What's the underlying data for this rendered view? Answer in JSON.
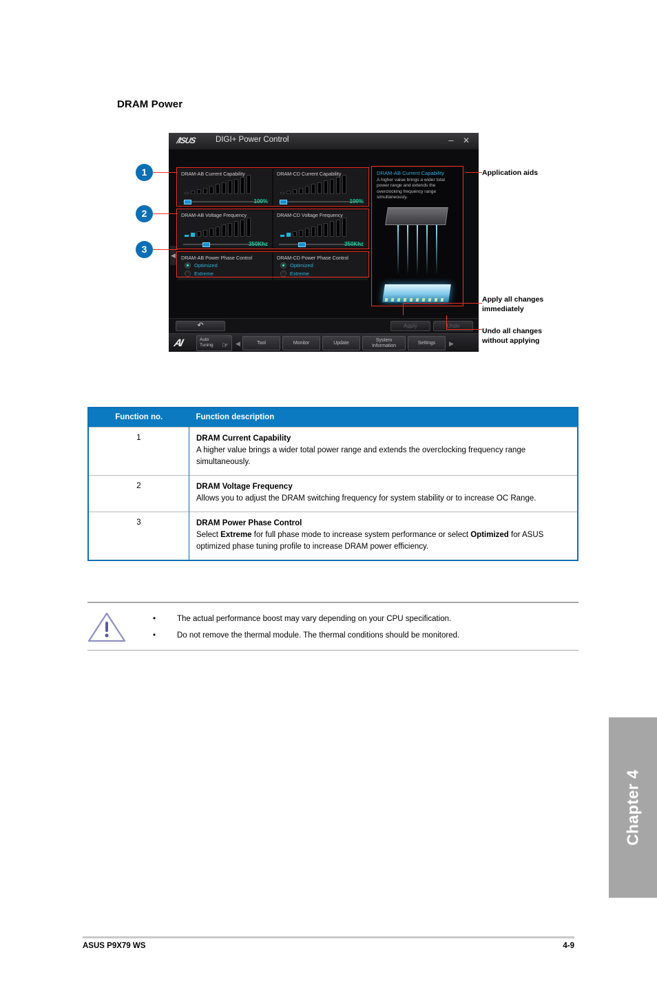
{
  "page": {
    "heading": "DRAM Power",
    "footer_left": "ASUS P9X79 WS",
    "footer_right": "4-9",
    "chapter_tab": "Chapter 4"
  },
  "colors": {
    "accent_blue": "#0b7ac0",
    "callout_blue": "#0b6fb5",
    "annotation_red": "#ee3124",
    "chapter_grey": "#a6a6a6",
    "app_value_green": "#16cfa0",
    "app_cyan": "#2fb3d8"
  },
  "app": {
    "brand": "/ISUS",
    "title": "DIGI+ Power Control",
    "window_buttons": {
      "minimize": "–",
      "close": "✕"
    },
    "left_collapse_icon": "◀",
    "panels": [
      {
        "title": "DRAM-AB Current Capability",
        "value": "100%",
        "slider_pct": 2,
        "lit_bars": 0
      },
      {
        "title": "DRAM-CD Current Capability",
        "value": "100%",
        "slider_pct": 2,
        "lit_bars": 0
      },
      {
        "title": "DRAM-AB Voltage Frequency",
        "value": "350Khz",
        "slider_pct": 26,
        "lit_bars": 2
      },
      {
        "title": "DRAM-CD Voltage Frequency",
        "value": "350Khz",
        "slider_pct": 26,
        "lit_bars": 2
      }
    ],
    "phase": [
      {
        "title": "DRAM-AB Power Phase Control",
        "options": [
          "Optimized",
          "Extreme"
        ],
        "selected": "Optimized"
      },
      {
        "title": "DRAM-CD Power Phase Control",
        "options": [
          "Optimized",
          "Extreme"
        ],
        "selected": "Optimized"
      }
    ],
    "aid": {
      "title": "DRAM-AB Current Capability",
      "text": "A higher value brings a wider total power range and extends the overclocking frequency range simultaneously."
    },
    "action_bar": {
      "back": "↶",
      "apply": "Apply",
      "undo": "Undo"
    },
    "nav": {
      "logo": "AI",
      "auto_tuning": "Auto\nTuning",
      "prev_arrow": "◀",
      "next_arrow": "▶",
      "buttons": [
        "Tool",
        "Monitor",
        "Update",
        "System\nInformation",
        "Settings"
      ]
    }
  },
  "callouts": [
    {
      "num": "1"
    },
    {
      "num": "2"
    },
    {
      "num": "3"
    }
  ],
  "annotations": {
    "aids": "Application aids",
    "apply": "Apply all changes\nimmediately",
    "undo": "Undo all changes\nwithout applying"
  },
  "table": {
    "headers": [
      "Function no.",
      "Function description"
    ],
    "rows": [
      {
        "no": "1",
        "title": "DRAM Current Capability",
        "desc": "A higher value brings a wider total power range and extends the overclocking frequency range simultaneously."
      },
      {
        "no": "2",
        "title": "DRAM Voltage Frequency",
        "desc": "Allows you to adjust the DRAM switching frequency for system stability or to increase OC Range."
      },
      {
        "no": "3",
        "title": "DRAM Power Phase Control",
        "desc_pre": "Select ",
        "desc_b1": "Extreme",
        "desc_mid": " for full phase mode to increase system performance or select ",
        "desc_b2": "Optimized",
        "desc_post": " for ASUS optimized phase tuning profile to increase DRAM power efficiency."
      }
    ]
  },
  "notes": {
    "bullet": "•",
    "items": [
      "The actual performance boost may vary depending on your CPU specification.",
      "Do not remove the thermal module. The thermal conditions should be monitored."
    ]
  }
}
